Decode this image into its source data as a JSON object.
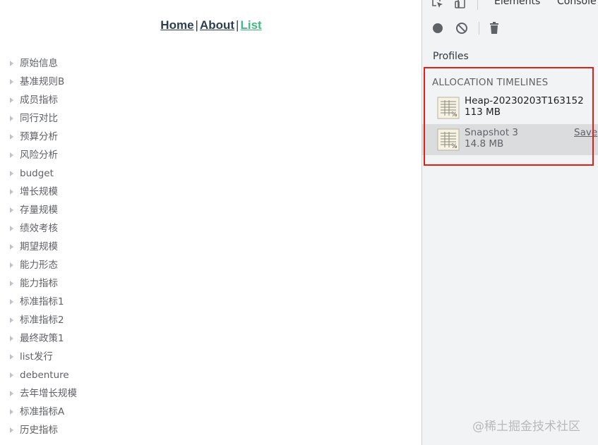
{
  "app": {
    "nav": {
      "home": "Home",
      "about": "About",
      "list": "List",
      "separator": "|"
    },
    "tree_items": [
      "原始信息",
      "基准规则B",
      "成员指标",
      "同行对比",
      "预算分析",
      "风险分析",
      "budget",
      "增长规模",
      "存量规模",
      "绩效考核",
      "期望规模",
      "能力形态",
      "能力指标",
      "标准指标1",
      "标准指标2",
      "最终政策1",
      "list发行",
      "debenture",
      "去年增长规模",
      "标准指标A",
      "历史指标"
    ]
  },
  "devtools": {
    "tabs": {
      "elements": "Elements",
      "console": "Console"
    },
    "profiles_label": "Profiles",
    "section_title": "ALLOCATION TIMELINES",
    "profiles": [
      {
        "name": "Heap-20230203T163152",
        "size": "113 MB",
        "selected": false,
        "action": ""
      },
      {
        "name": "Snapshot 3",
        "size": "14.8 MB",
        "selected": true,
        "action": "Save"
      }
    ]
  },
  "watermark": "@稀土掘金技术社区",
  "colors": {
    "active_link": "#42b983",
    "link": "#2c3e50",
    "highlight_border": "#e0211a",
    "devtools_bg": "#f1f3f4"
  }
}
